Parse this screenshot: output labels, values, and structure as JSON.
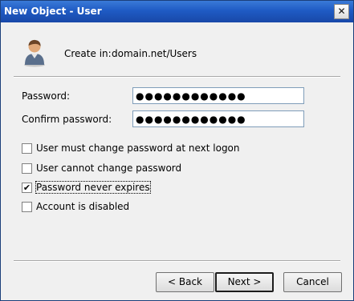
{
  "window": {
    "title": "New Object - User",
    "close_glyph": "✕"
  },
  "header": {
    "icon": "user-icon",
    "create_in_label": "Create in:",
    "create_in_value": "domain.net/Users"
  },
  "form": {
    "password_label": "Password:",
    "password_value": "●●●●●●●●●●●●",
    "confirm_label": "Confirm password:",
    "confirm_value": "●●●●●●●●●●●●"
  },
  "options": [
    {
      "label": "User must change password at next logon",
      "checked": false
    },
    {
      "label": "User cannot change password",
      "checked": false
    },
    {
      "label": "Password never expires",
      "checked": true
    },
    {
      "label": "Account is disabled",
      "checked": false
    }
  ],
  "buttons": {
    "back": "< Back",
    "next": "Next >",
    "cancel": "Cancel"
  },
  "colors": {
    "titlebar": "#1f5bc4",
    "dialog_bg": "#f0f0f0"
  }
}
